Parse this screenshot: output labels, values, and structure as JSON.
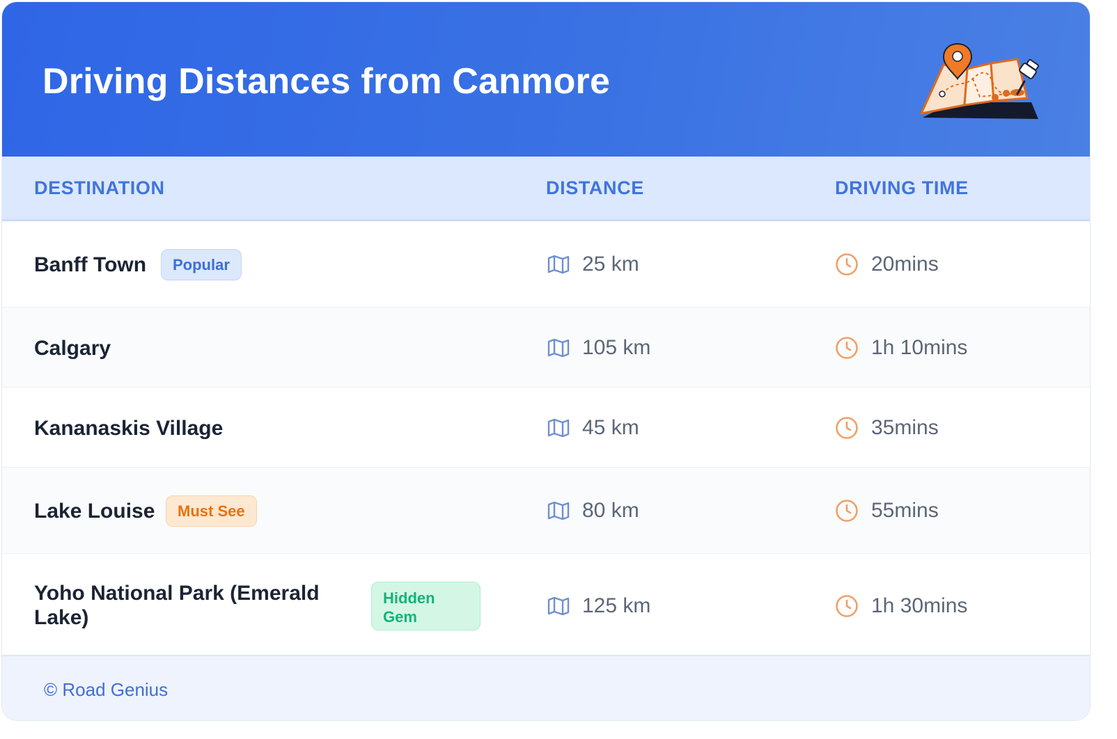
{
  "header": {
    "title": "Driving Distances from Canmore",
    "illustration_icon": "map-with-pins-icon"
  },
  "table": {
    "columns": [
      "DESTINATION",
      "DISTANCE",
      "DRIVING TIME"
    ],
    "rows": [
      {
        "destination": "Banff Town",
        "badge": "Popular",
        "distance": "25 km",
        "time": "20mins"
      },
      {
        "destination": "Calgary",
        "badge": "",
        "distance": "105 km",
        "time": "1h 10mins"
      },
      {
        "destination": "Kananaskis Village",
        "badge": "",
        "distance": "45 km",
        "time": "35mins"
      },
      {
        "destination": "Lake Louise",
        "badge": "Must See",
        "distance": "80 km",
        "time": "55mins"
      },
      {
        "destination": "Yoho National Park (Emerald Lake)",
        "badge": "Hidden Gem",
        "distance": "125 km",
        "time": "1h 30mins"
      }
    ],
    "icons": {
      "distance": "map-icon",
      "time": "clock-icon"
    }
  },
  "footer": {
    "text": "© Road Genius"
  },
  "colors": {
    "header_gradient_start": "#2f66e6",
    "header_gradient_end": "#4a80e4",
    "column_header_text": "#4174dc",
    "popular_badge": "#3b6fd8",
    "must_see_badge": "#e8720f",
    "hidden_gem_badge": "#14b37a",
    "clock_icon": "#f0a068",
    "map_icon": "#6f8fd4"
  }
}
